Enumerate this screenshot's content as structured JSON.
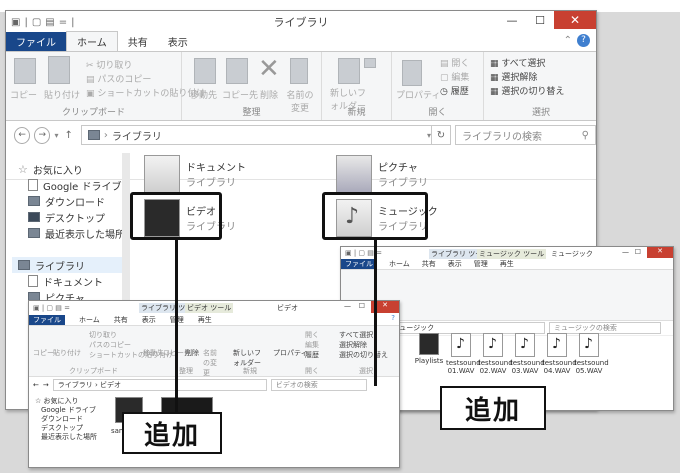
{
  "main_window": {
    "title": "ライブラリ",
    "qat": [
      "▣",
      "|",
      "▢",
      "▤",
      "=",
      "|"
    ],
    "tabs": [
      "ファイル",
      "ホーム",
      "共有",
      "表示"
    ],
    "ribbon": {
      "clipboard": {
        "copy": "コピー",
        "paste": "貼り付け",
        "cut": "切り取り",
        "copy_path": "パスのコピー",
        "paste_shortcut": "ショートカットの貼り付け",
        "label": "クリップボード"
      },
      "organize": {
        "move_to": "移動先",
        "copy_to": "コピー先",
        "delete": "削除",
        "rename": "名前の変更",
        "label": "整理"
      },
      "new": {
        "new_folder": "新しいフォルダー",
        "label": "新規"
      },
      "open": {
        "properties": "プロパティ",
        "open": "開く",
        "edit": "編集",
        "history": "履歴",
        "label": "開く"
      },
      "select": {
        "select_all": "すべて選択",
        "select_none": "選択解除",
        "invert": "選択の切り替え",
        "label": "選択"
      }
    },
    "address": {
      "path": "ライブラリ",
      "search_placeholder": "ライブラリの検索"
    },
    "nav": {
      "favorites": "お気に入り",
      "fav_items": [
        "Google ドライブ",
        "ダウンロード",
        "デスクトップ",
        "最近表示した場所"
      ],
      "libraries": "ライブラリ",
      "lib_items": [
        "ドキュメント",
        "ピクチャ"
      ]
    },
    "libraries": [
      {
        "name": "ドキュメント",
        "sub": "ライブラリ"
      },
      {
        "name": "ピクチャ",
        "sub": "ライブラリ"
      },
      {
        "name": "ビデオ",
        "sub": "ライブラリ"
      },
      {
        "name": "ミュージック",
        "sub": "ライブラリ"
      }
    ]
  },
  "music_window": {
    "title": "ミュージック",
    "context_tabs": [
      "ライブラリ ツール",
      "ミュージック ツール"
    ],
    "tabs": [
      "ファイル",
      "ホーム",
      "共有",
      "表示",
      "管理",
      "再生"
    ],
    "address": {
      "path": "ライブラリ › ミュージック",
      "search_placeholder": "ミュージックの検索"
    },
    "files": [
      "Playlists",
      "testsound 01.WAV",
      "testsound 02.WAV",
      "testsound 03.WAV",
      "testsound 04.WAV",
      "testsound 05.WAV"
    ]
  },
  "video_window": {
    "title": "ビデオ",
    "context_tabs": [
      "ライブラリ ツール",
      "ビデオ ツール"
    ],
    "tabs": [
      "ファイル",
      "ホーム",
      "共有",
      "表示",
      "管理",
      "再生"
    ],
    "ribbon": {
      "copy": "コピー",
      "paste": "貼り付け",
      "cut": "切り取り",
      "copy_path": "パスのコピー",
      "paste_shortcut": "ショートカットの貼り付け",
      "clip_label": "クリップボード",
      "move_to": "移動先",
      "copy_to": "コピー先",
      "delete": "削除",
      "rename": "名前の変更",
      "org_label": "整理",
      "new_folder": "新しいフォルダー",
      "new_label": "新規",
      "properties": "プロパティ",
      "open": "開く",
      "edit": "編集",
      "history": "履歴",
      "open_label": "開く",
      "select_all": "すべて選択",
      "select_none": "選択解除",
      "invert": "選択の切り替え",
      "select_label": "選択"
    },
    "address": {
      "path": "ライブラリ › ビデオ",
      "search_placeholder": "ビデオの検索"
    },
    "nav": {
      "favorites": "お気に入り",
      "fav_items": [
        "Google ドライブ",
        "ダウンロード",
        "デスクトップ",
        "最近表示した場所"
      ]
    },
    "file": "sam"
  },
  "callouts": {
    "add_left": "追加",
    "add_right": "追加"
  }
}
